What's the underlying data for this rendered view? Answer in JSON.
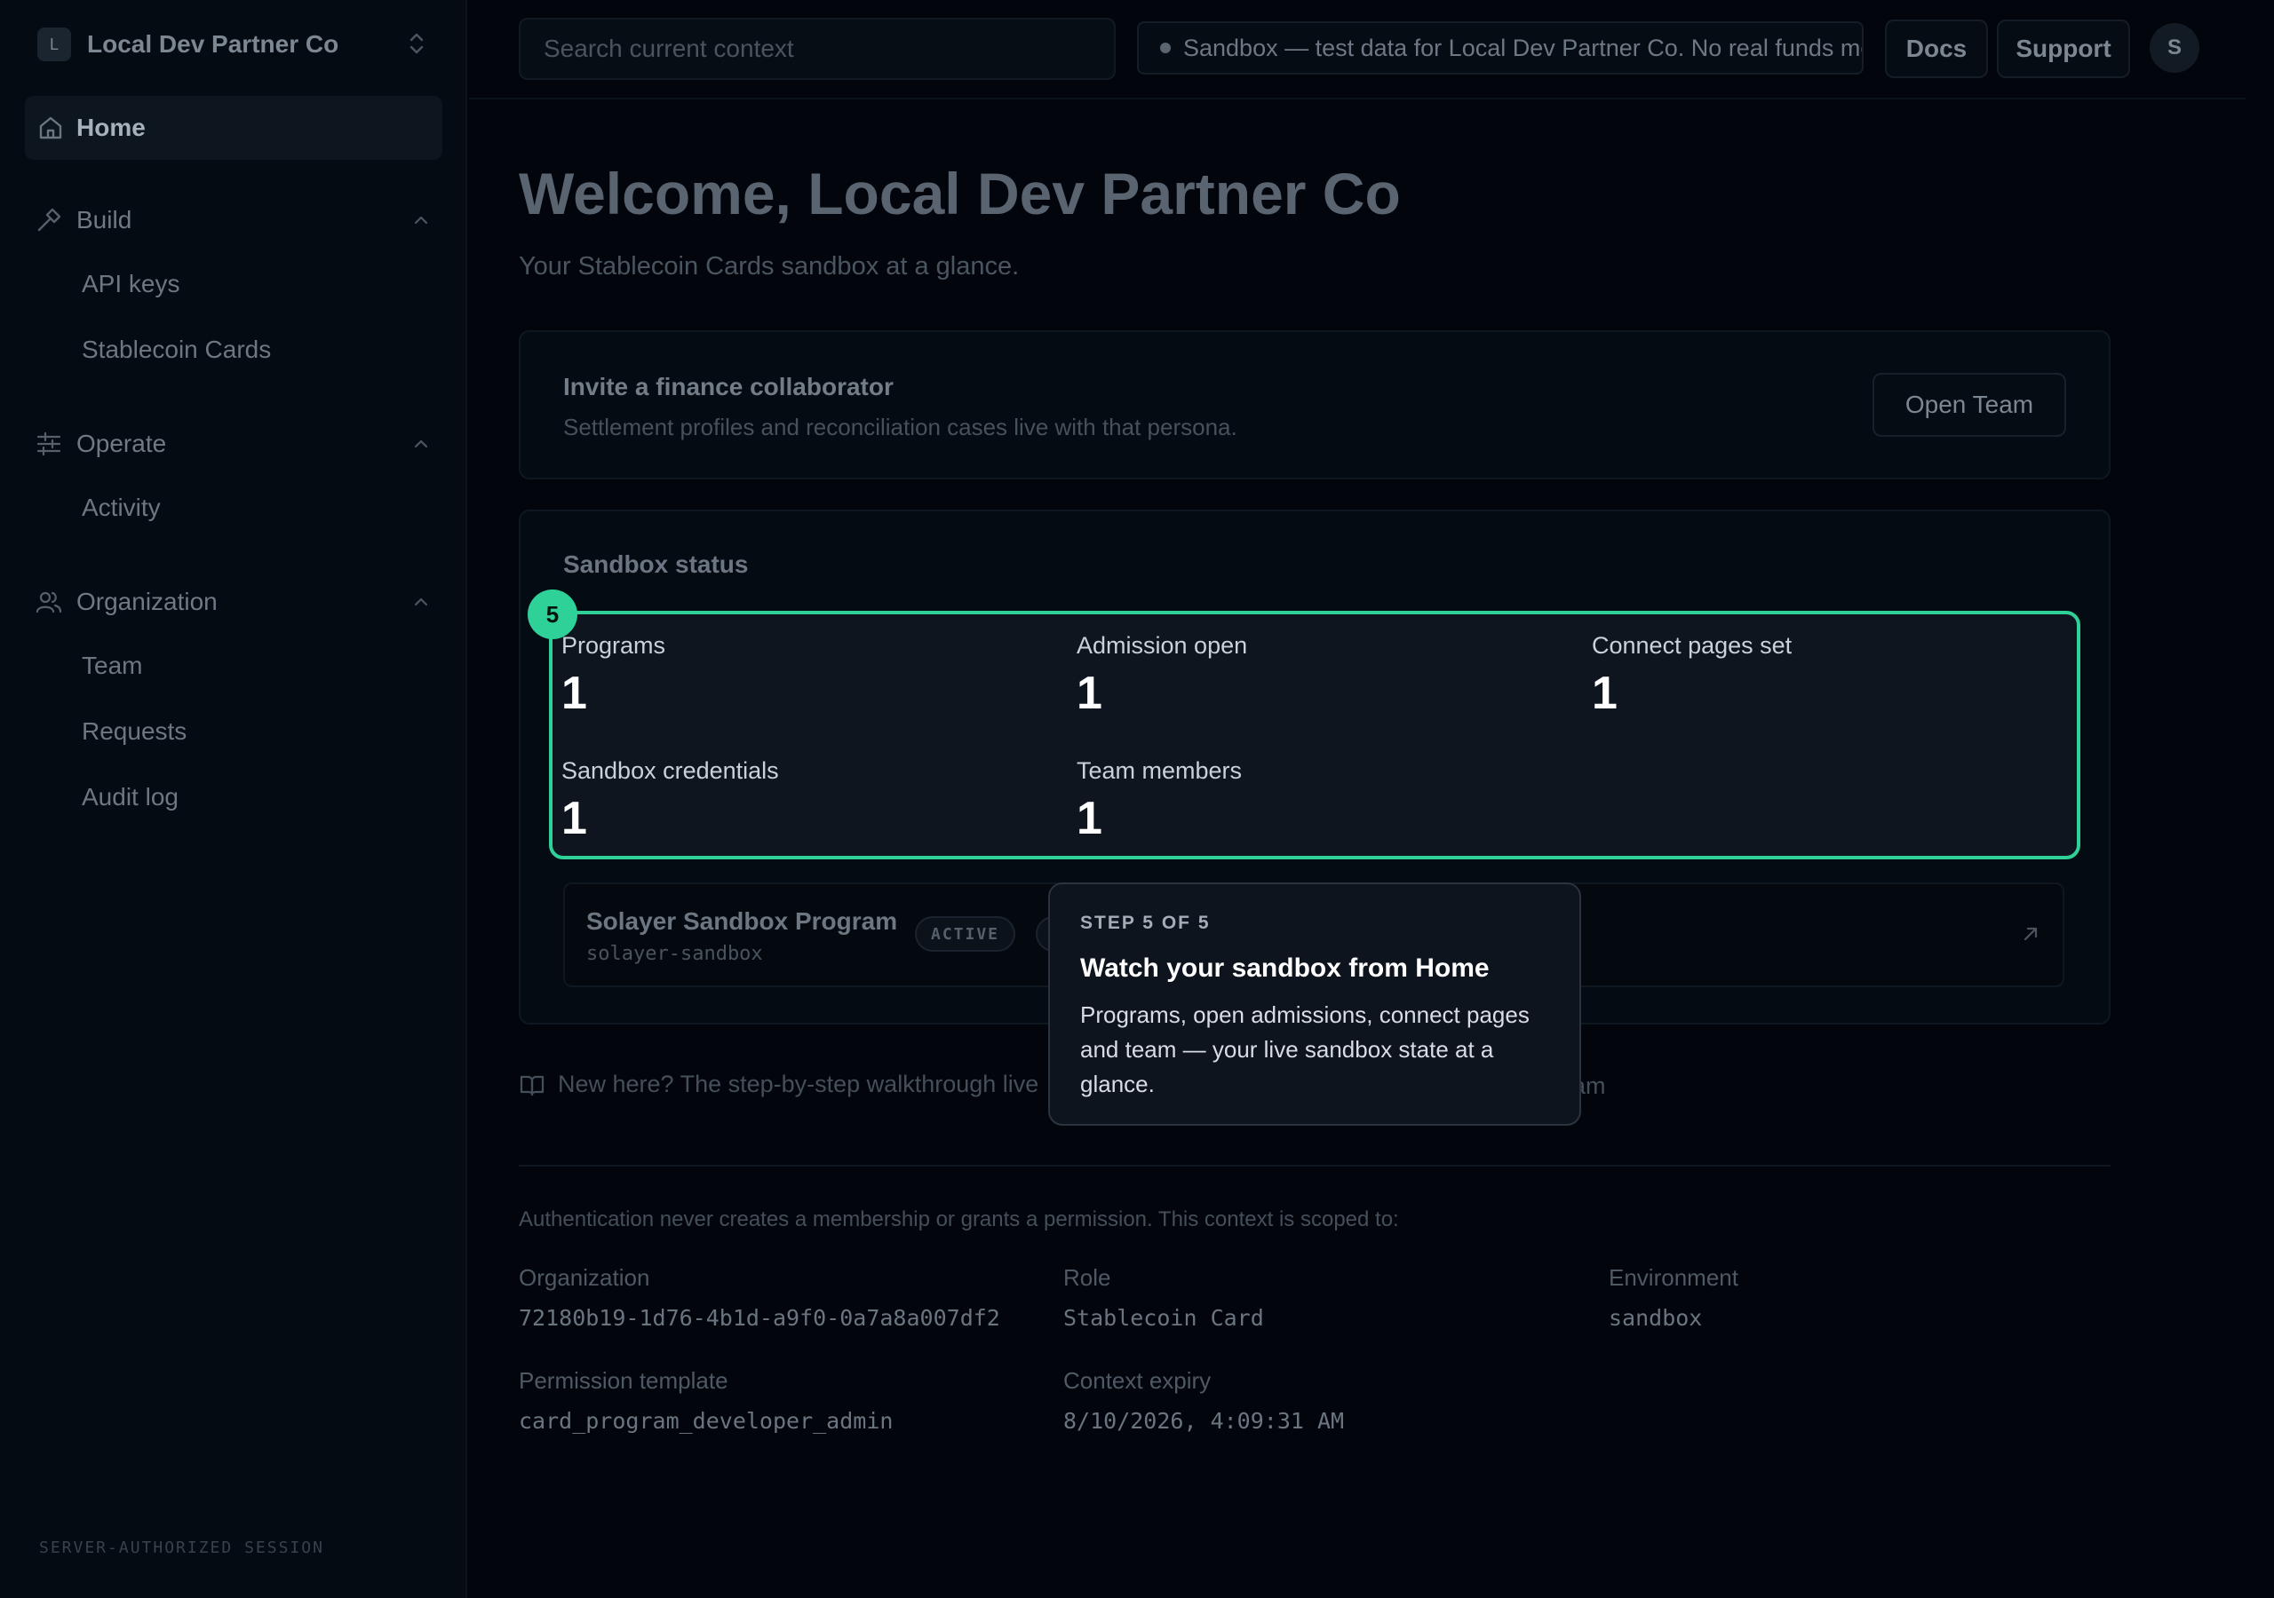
{
  "sidebar": {
    "org_initial": "L",
    "org_name": "Local Dev Partner Co",
    "home_label": "Home",
    "groups": [
      {
        "label": "Build",
        "items": [
          "API keys",
          "Stablecoin Cards"
        ]
      },
      {
        "label": "Operate",
        "items": [
          "Activity"
        ]
      },
      {
        "label": "Organization",
        "items": [
          "Team",
          "Requests",
          "Audit log"
        ]
      }
    ],
    "footer": "SERVER-AUTHORIZED SESSION"
  },
  "topbar": {
    "search_placeholder": "Search current context",
    "env_banner": "Sandbox — test data for Local Dev Partner Co. No real funds mo",
    "docs_label": "Docs",
    "support_label": "Support",
    "user_initial": "S"
  },
  "main": {
    "welcome": "Welcome, Local Dev Partner Co",
    "subtitle": "Your Stablecoin Cards sandbox at a glance.",
    "invite": {
      "title": "Invite a finance collaborator",
      "desc": "Settlement profiles and reconciliation cases live with that persona.",
      "button": "Open Team"
    },
    "status": {
      "title": "Sandbox status",
      "step_number": "5",
      "stats": [
        {
          "label": "Programs",
          "value": "1"
        },
        {
          "label": "Admission open",
          "value": "1"
        },
        {
          "label": "Connect pages set",
          "value": "1"
        },
        {
          "label": "Sandbox credentials",
          "value": "1"
        },
        {
          "label": "Team members",
          "value": "1"
        }
      ],
      "program": {
        "name": "Solayer Sandbox Program",
        "slug": "solayer-sandbox",
        "status": "ACTIVE"
      }
    },
    "walkthrough_text": "New here? The step-by-step walkthrough live",
    "walkthrough_tail": "am",
    "auth_note": "Authentication never creates a membership or grants a permission. This context is scoped to:",
    "context": {
      "organization_label": "Organization",
      "organization_value": "72180b19-1d76-4b1d-a9f0-0a7a8a007df2",
      "role_label": "Role",
      "role_value": "Stablecoin Card",
      "environment_label": "Environment",
      "environment_value": "sandbox",
      "template_label": "Permission template",
      "template_value": "card_program_developer_admin",
      "expiry_label": "Context expiry",
      "expiry_value": "8/10/2026, 4:09:31 AM"
    }
  },
  "tooltip": {
    "step": "STEP 5 OF 5",
    "title": "Watch your sandbox from Home",
    "body": "Programs, open admissions, connect pages and team — your live sandbox state at a glance."
  },
  "colors": {
    "accent": "#2ed197",
    "background": "#02060c"
  }
}
